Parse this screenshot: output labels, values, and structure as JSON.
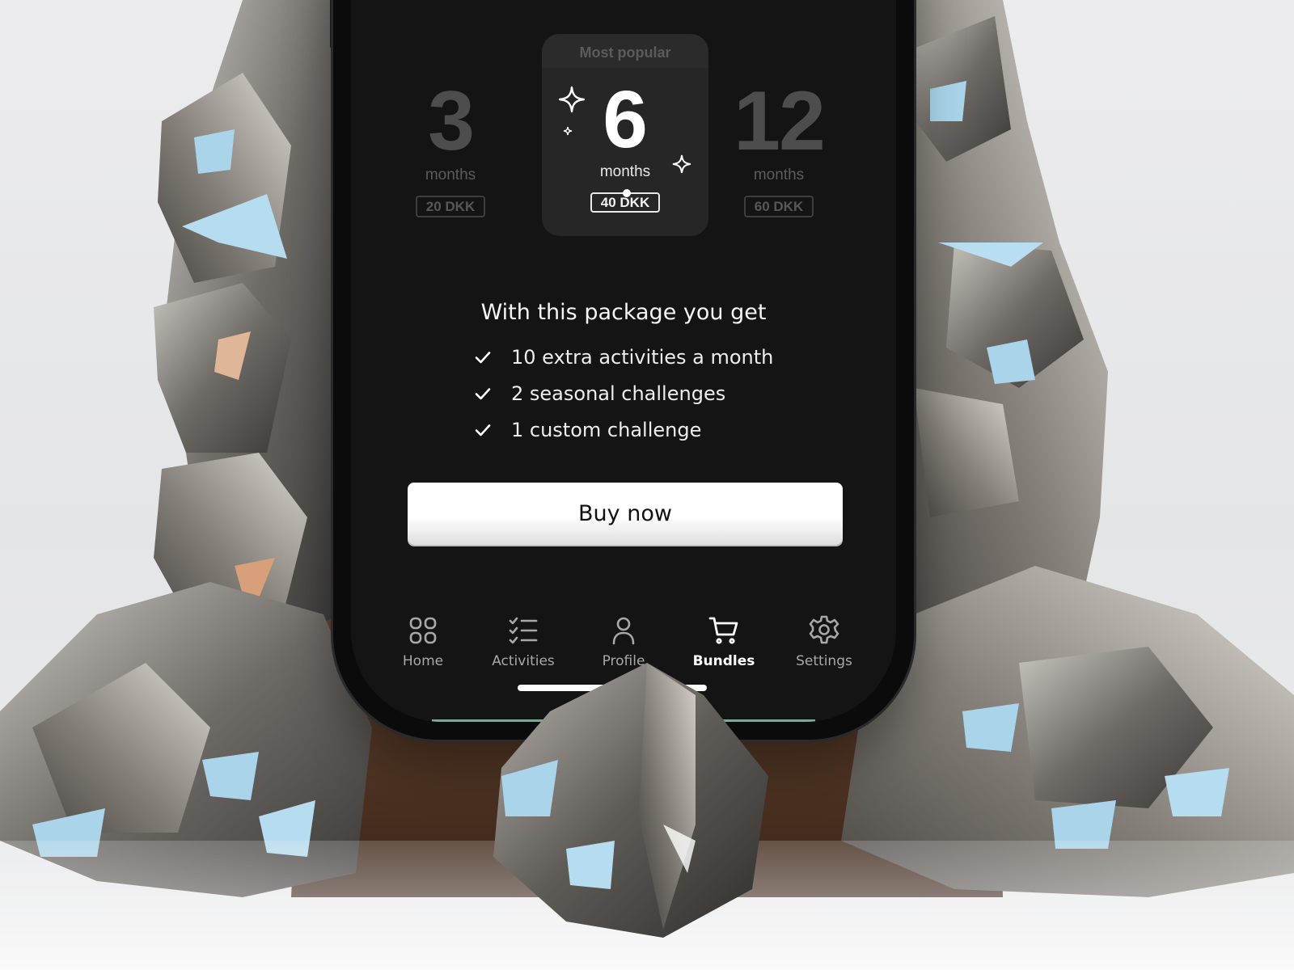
{
  "plans": [
    {
      "number": "3",
      "unit": "months",
      "price": "20 DKK"
    },
    {
      "number": "6",
      "unit": "months",
      "price": "40 DKK",
      "badge": "Most popular",
      "selected": true
    },
    {
      "number": "12",
      "unit": "months",
      "price": "60 DKK"
    }
  ],
  "benefits": {
    "title": "With this package you get",
    "items": [
      "10 extra activities a month",
      "2 seasonal challenges",
      "1 custom challenge"
    ]
  },
  "cta": {
    "label": "Buy now"
  },
  "tabbar": [
    {
      "label": "Home",
      "icon": "grid-icon"
    },
    {
      "label": "Activities",
      "icon": "checklist-icon"
    },
    {
      "label": "Profile",
      "icon": "user-icon"
    },
    {
      "label": "Bundles",
      "icon": "cart-icon",
      "active": true
    },
    {
      "label": "Settings",
      "icon": "gear-icon"
    }
  ],
  "colors": {
    "screen_bg": "#141414",
    "card_bg": "#262626",
    "accent_line": "#7fa898",
    "crystal_blue": "#a9d4ea"
  }
}
